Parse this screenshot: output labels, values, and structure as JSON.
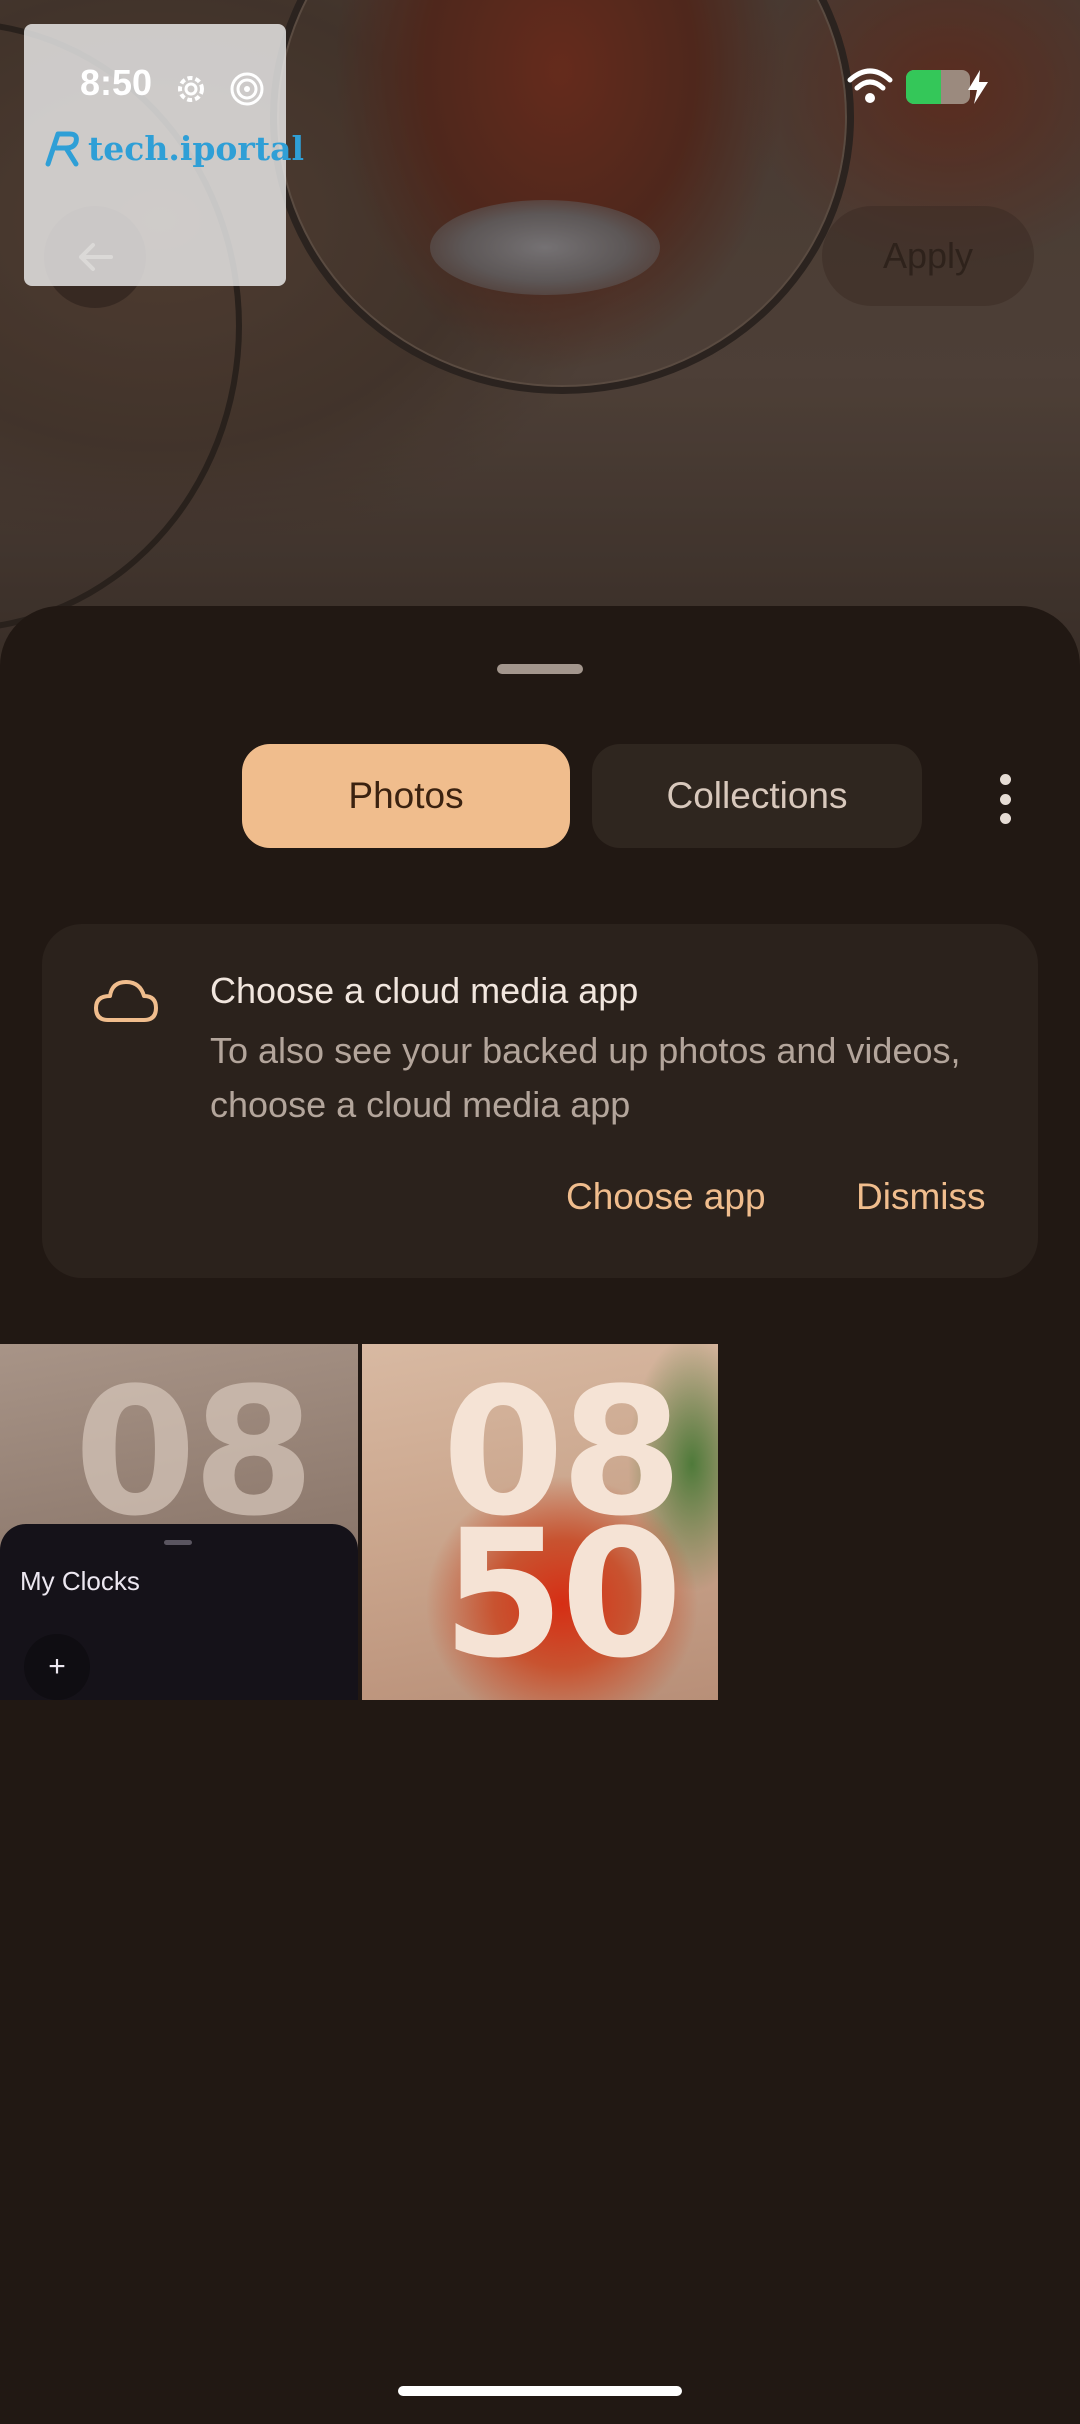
{
  "status_bar": {
    "time": "8:50",
    "battery_level_pct": 55,
    "icons": [
      "gear-icon",
      "spiral-icon",
      "wifi-icon",
      "battery-icon",
      "charging-icon"
    ]
  },
  "watermark": {
    "brand": "tech.iportal"
  },
  "toolbar": {
    "apply_label": "Apply",
    "back_icon": "arrow-back-icon"
  },
  "tabs": [
    {
      "label": "Photos",
      "selected": true
    },
    {
      "label": "Collections",
      "selected": false
    }
  ],
  "cloud_card": {
    "icon": "cloud-icon",
    "title": "Choose a cloud media app",
    "body": "To also see your backed up photos and videos, choose a cloud media app",
    "choose_label": "Choose app",
    "dismiss_label": "Dismiss"
  },
  "grid": {
    "tiles": [
      {
        "hour": "08",
        "minute": ""
      },
      {
        "hour": "08",
        "minute": "50"
      }
    ]
  },
  "clocks_panel": {
    "title": "My Clocks",
    "add_label": "+"
  },
  "colors": {
    "accent": "#f0bd8d",
    "sheet_bg": "#211813",
    "card_bg": "#2b221c"
  }
}
